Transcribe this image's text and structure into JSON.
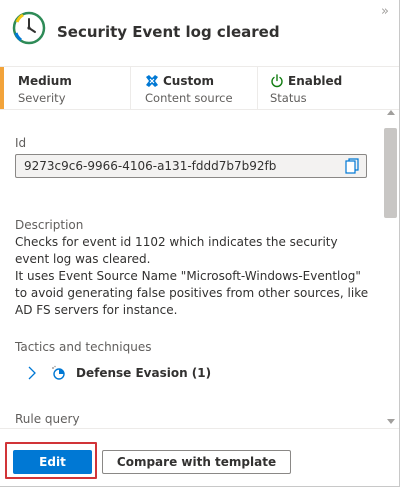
{
  "header": {
    "title": "Security Event log cleared",
    "expand_glyph": "»",
    "app_icon": "clock-icon"
  },
  "info": {
    "severity": {
      "value": "Medium",
      "label": "Severity"
    },
    "source": {
      "value": "Custom",
      "label": "Content source",
      "icon": "custom-source-icon"
    },
    "status": {
      "value": "Enabled",
      "label": "Status",
      "icon": "power-icon"
    }
  },
  "details": {
    "id_label": "Id",
    "id_value": "9273c9c6-9966-4106-a131-fddd7b7b92fb",
    "description_label": "Description",
    "description_lines": [
      "Checks for event id 1102 which indicates the security event log was cleared.",
      "It uses Event Source Name \"Microsoft-Windows-Eventlog\" to avoid generating false positives from other sources, like AD FS servers for instance."
    ],
    "tactics_label": "Tactics and techniques",
    "tactic": "Defense Evasion (1)",
    "rule_query_label": "Rule query"
  },
  "footer": {
    "edit_label": "Edit",
    "compare_label": "Compare with template"
  },
  "colors": {
    "accent_strip": "#f2a33a",
    "primary": "#0078d4",
    "highlight": "#d13438",
    "enabled_green": "#107c10"
  }
}
